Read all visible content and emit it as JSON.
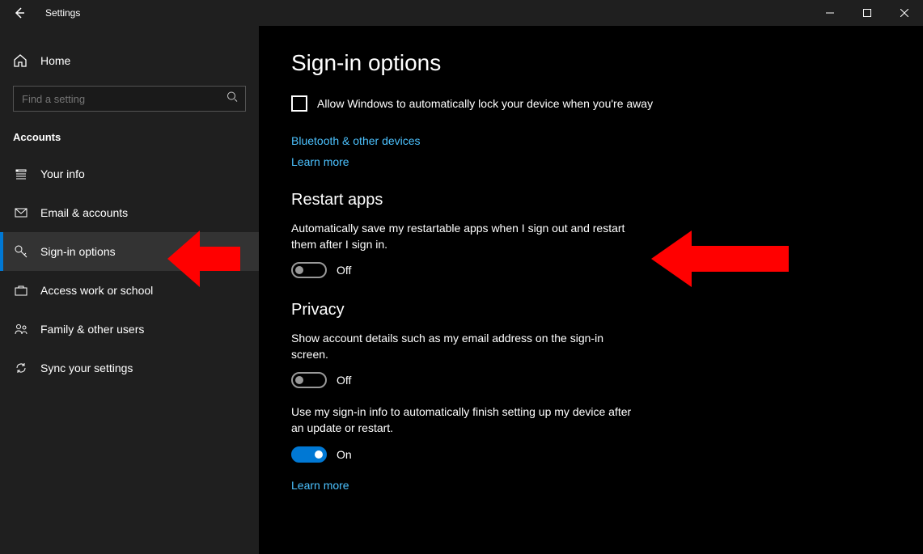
{
  "window": {
    "title": "Settings"
  },
  "sidebar": {
    "home": "Home",
    "search_placeholder": "Find a setting",
    "section": "Accounts",
    "items": [
      {
        "label": "Your info"
      },
      {
        "label": "Email & accounts"
      },
      {
        "label": "Sign-in options"
      },
      {
        "label": "Access work or school"
      },
      {
        "label": "Family & other users"
      },
      {
        "label": "Sync your settings"
      }
    ]
  },
  "page": {
    "title": "Sign-in options",
    "lock_checkbox": "Allow Windows to automatically lock your device when you're away",
    "bluetooth_link": "Bluetooth & other devices",
    "learn_more": "Learn more",
    "restart_h": "Restart apps",
    "restart_desc": "Automatically save my restartable apps when I sign out and restart them after I sign in.",
    "off": "Off",
    "on": "On",
    "privacy_h": "Privacy",
    "privacy_desc1": "Show account details such as my email address on the sign-in screen.",
    "privacy_desc2": "Use my sign-in info to automatically finish setting up my device after an update or restart."
  }
}
